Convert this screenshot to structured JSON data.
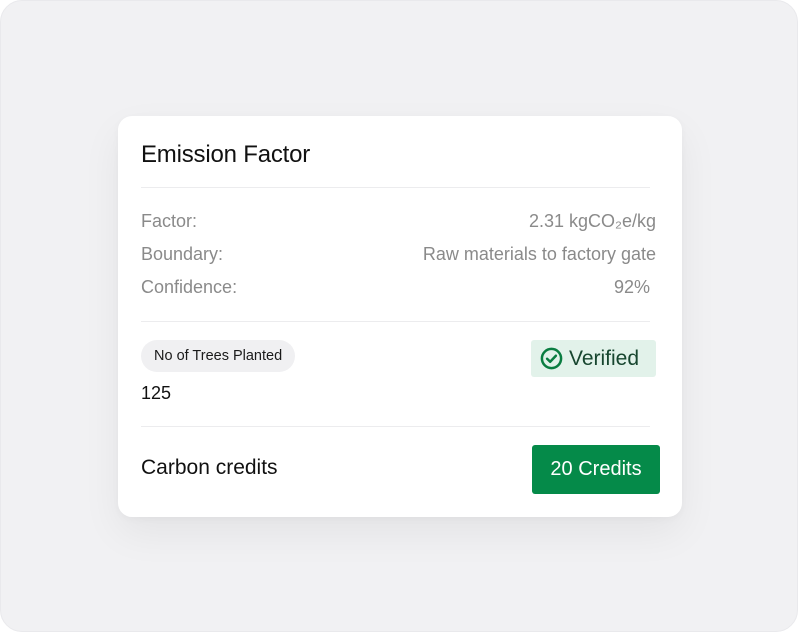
{
  "card": {
    "title": "Emission Factor",
    "details": [
      {
        "label": "Factor:",
        "value": "2.31 kgCO₂e/kg"
      },
      {
        "label": "Boundary:",
        "value": "Raw materials to factory gate"
      },
      {
        "label": "Confidence:",
        "value": "92%"
      }
    ],
    "trees": {
      "label": "No of Trees Planted",
      "value": "125"
    },
    "verified": {
      "label": "Verified",
      "icon": "check-circle-icon",
      "color": "#0a7d41",
      "background": "#e2f2ea"
    },
    "credits": {
      "label": "Carbon credits",
      "button_label": "20 Credits",
      "button_color": "#058a49"
    }
  }
}
